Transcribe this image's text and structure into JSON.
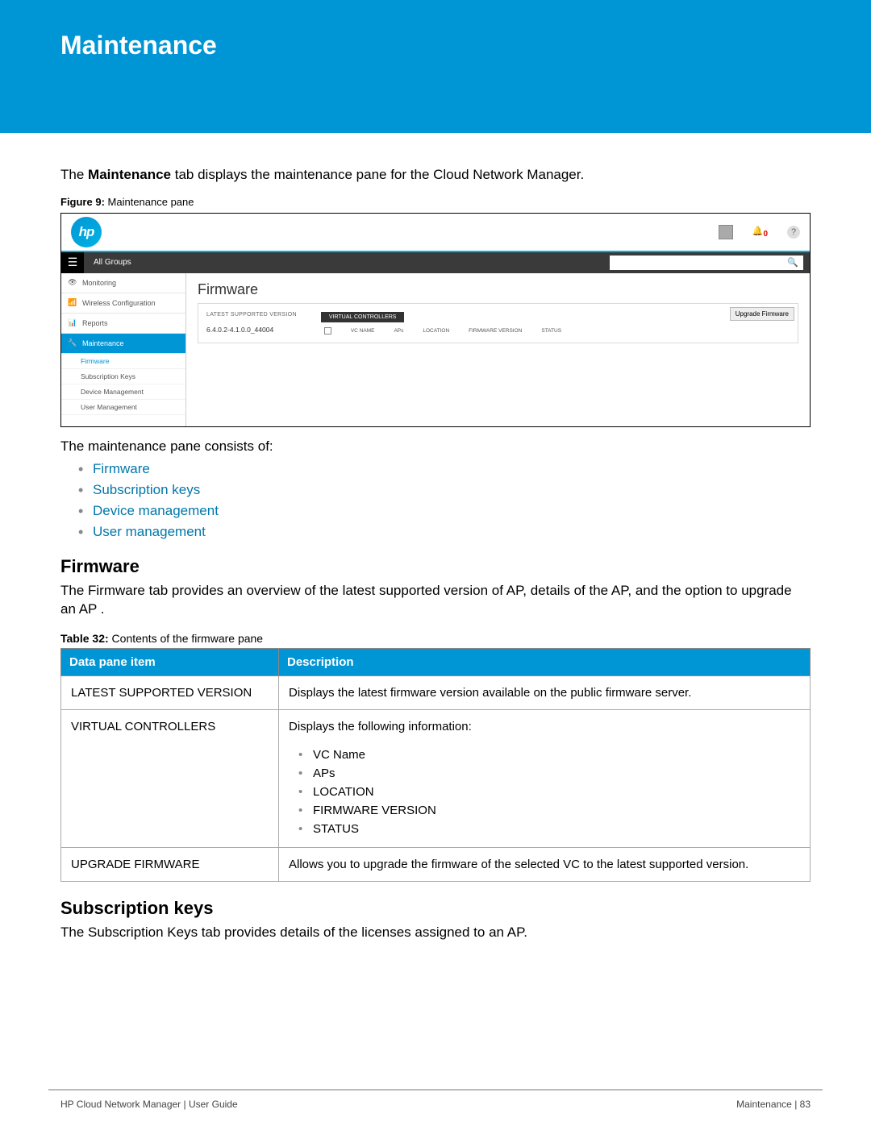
{
  "chapter_title": "Maintenance",
  "intro": {
    "pre": "The ",
    "bold": "Maintenance",
    "post": " tab displays the maintenance pane for the Cloud Network Manager."
  },
  "figure": {
    "label": "Figure 9:",
    "text": "Maintenance pane"
  },
  "screenshot": {
    "logo": "hp",
    "alerts": "0",
    "help": "?",
    "breadcrumb": "All Groups",
    "search_icon": "🔍",
    "sidebar": {
      "monitoring": "Monitoring",
      "wireless": "Wireless Configuration",
      "reports": "Reports",
      "maintenance": "Maintenance",
      "sub_firmware": "Firmware",
      "sub_subkeys": "Subscription Keys",
      "sub_device": "Device Management",
      "sub_user": "User Management"
    },
    "main": {
      "title": "Firmware",
      "latest_label": "LATEST SUPPORTED VERSION",
      "latest_value": "6.4.0.2-4.1.0.0_44004",
      "vc_tab": "VIRTUAL CONTROLLERS",
      "cols": {
        "vc": "VC NAME",
        "aps": "APs",
        "loc": "LOCATION",
        "fw": "FIRMWARE VERSION",
        "st": "STATUS"
      },
      "upgrade_btn": "Upgrade Firmware"
    }
  },
  "consists_of": "The maintenance pane consists of:",
  "links": {
    "firmware": "Firmware",
    "subkeys": "Subscription keys",
    "device": "Device management",
    "user": "User management"
  },
  "section_firmware": {
    "title": "Firmware",
    "para": "The Firmware tab provides an overview of the latest supported version of AP, details of the AP, and the option to upgrade an AP ."
  },
  "table_caption": {
    "label": "Table 32:",
    "text": "Contents of the firmware pane"
  },
  "table": {
    "head_item": "Data pane item",
    "head_desc": "Description",
    "rows": [
      {
        "item": "LATEST SUPPORTED VERSION",
        "desc": "Displays the latest firmware version available on the public firmware server."
      },
      {
        "item": "VIRTUAL CONTROLLERS",
        "desc_intro": "Displays the following information:",
        "bullets": [
          "VC Name",
          "APs",
          "LOCATION",
          "FIRMWARE VERSION",
          "STATUS"
        ]
      },
      {
        "item": "UPGRADE FIRMWARE",
        "desc": "Allows you to upgrade the firmware of the selected VC to the latest supported version."
      }
    ]
  },
  "section_subkeys": {
    "title": "Subscription keys",
    "para": "The Subscription Keys tab provides details of the licenses assigned to an AP."
  },
  "footer": {
    "left": "HP Cloud Network Manager | User Guide",
    "right": "Maintenance  |  83"
  }
}
